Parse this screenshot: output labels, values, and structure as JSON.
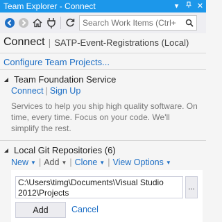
{
  "window": {
    "title": "Team Explorer - Connect",
    "pin_glyph": "▾",
    "close_glyph": "✕"
  },
  "toolbar": {
    "back_icon": "back-arrow-icon",
    "forward_icon": "forward-arrow-icon",
    "home_icon": "home-icon",
    "connect_icon": "plug-icon",
    "refresh_icon": "refresh-icon",
    "search_placeholder": "Search Work Items (Ctrl+",
    "search_icon": "search-icon"
  },
  "header": {
    "title": "Connect",
    "context": "SATP-Event-Registrations (Local)"
  },
  "configure_link": "Configure Team Projects...",
  "tfs": {
    "title": "Team Foundation Service",
    "connect_label": "Connect",
    "signup_label": "Sign Up",
    "description": "Services to help you ship high quality software. On time, every time. Focus on your code. We'll simplify the rest."
  },
  "git": {
    "title": "Local Git Repositories (6)",
    "tools": {
      "new_label": "New",
      "add_label": "Add",
      "clone_label": "Clone",
      "view_options_label": "View Options"
    },
    "path_value": "C:\\Users\\timg\\Documents\\Visual Studio 2012\\Projects",
    "browse_label": "...",
    "add_button_label": "Add",
    "cancel_label": "Cancel"
  },
  "colors": {
    "accent": "#1c97ea",
    "link": "#1e6fc5",
    "background": "#f5f5f5"
  }
}
